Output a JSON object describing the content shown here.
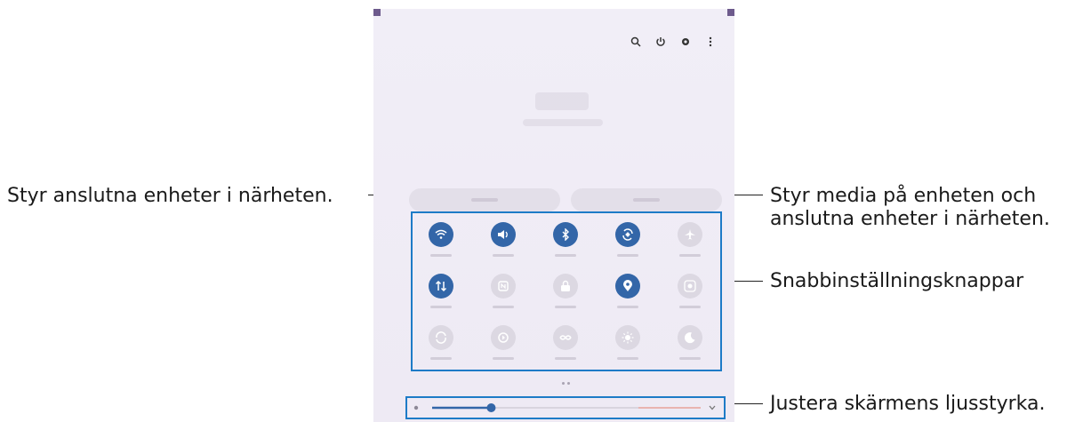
{
  "annotations": {
    "nearby_devices": "Styr anslutna enheter i närheten.",
    "media_line1": "Styr media på enheten och",
    "media_line2": "anslutna enheter i närheten.",
    "quick_settings": "Snabbinställningsknappar",
    "brightness": "Justera skärmens ljusstyrka."
  },
  "top_icons": [
    "search-icon",
    "power-icon",
    "settings-icon",
    "more-options-icon"
  ],
  "quick_settings": [
    {
      "name": "wifi",
      "active": true,
      "icon": "wifi-icon"
    },
    {
      "name": "sound",
      "active": true,
      "icon": "volume-icon"
    },
    {
      "name": "bluetooth",
      "active": true,
      "icon": "bluetooth-icon"
    },
    {
      "name": "auto-rotate",
      "active": true,
      "icon": "rotate-icon"
    },
    {
      "name": "airplane-mode",
      "active": false,
      "icon": "airplane-icon"
    },
    {
      "name": "mobile-data",
      "active": true,
      "icon": "data-transfer-icon"
    },
    {
      "name": "nfc",
      "active": false,
      "icon": "nfc-icon"
    },
    {
      "name": "secure-folder",
      "active": false,
      "icon": "lock-icon"
    },
    {
      "name": "location",
      "active": true,
      "icon": "location-pin-icon"
    },
    {
      "name": "screen-recorder",
      "active": false,
      "icon": "screen-record-icon"
    },
    {
      "name": "power-saving",
      "active": false,
      "icon": "power-saving-icon"
    },
    {
      "name": "device-care",
      "active": false,
      "icon": "refresh-icon"
    },
    {
      "name": "nearby-share",
      "active": false,
      "icon": "share-icon"
    },
    {
      "name": "eye-comfort",
      "active": false,
      "icon": "sun-icon"
    },
    {
      "name": "dark-mode",
      "active": false,
      "icon": "moon-icon"
    }
  ],
  "brightness": {
    "level": 0.22
  },
  "colors": {
    "accent": "#1d7bc7",
    "tile_on": "#3366a8",
    "panel_corner": "#6d5a8c"
  }
}
